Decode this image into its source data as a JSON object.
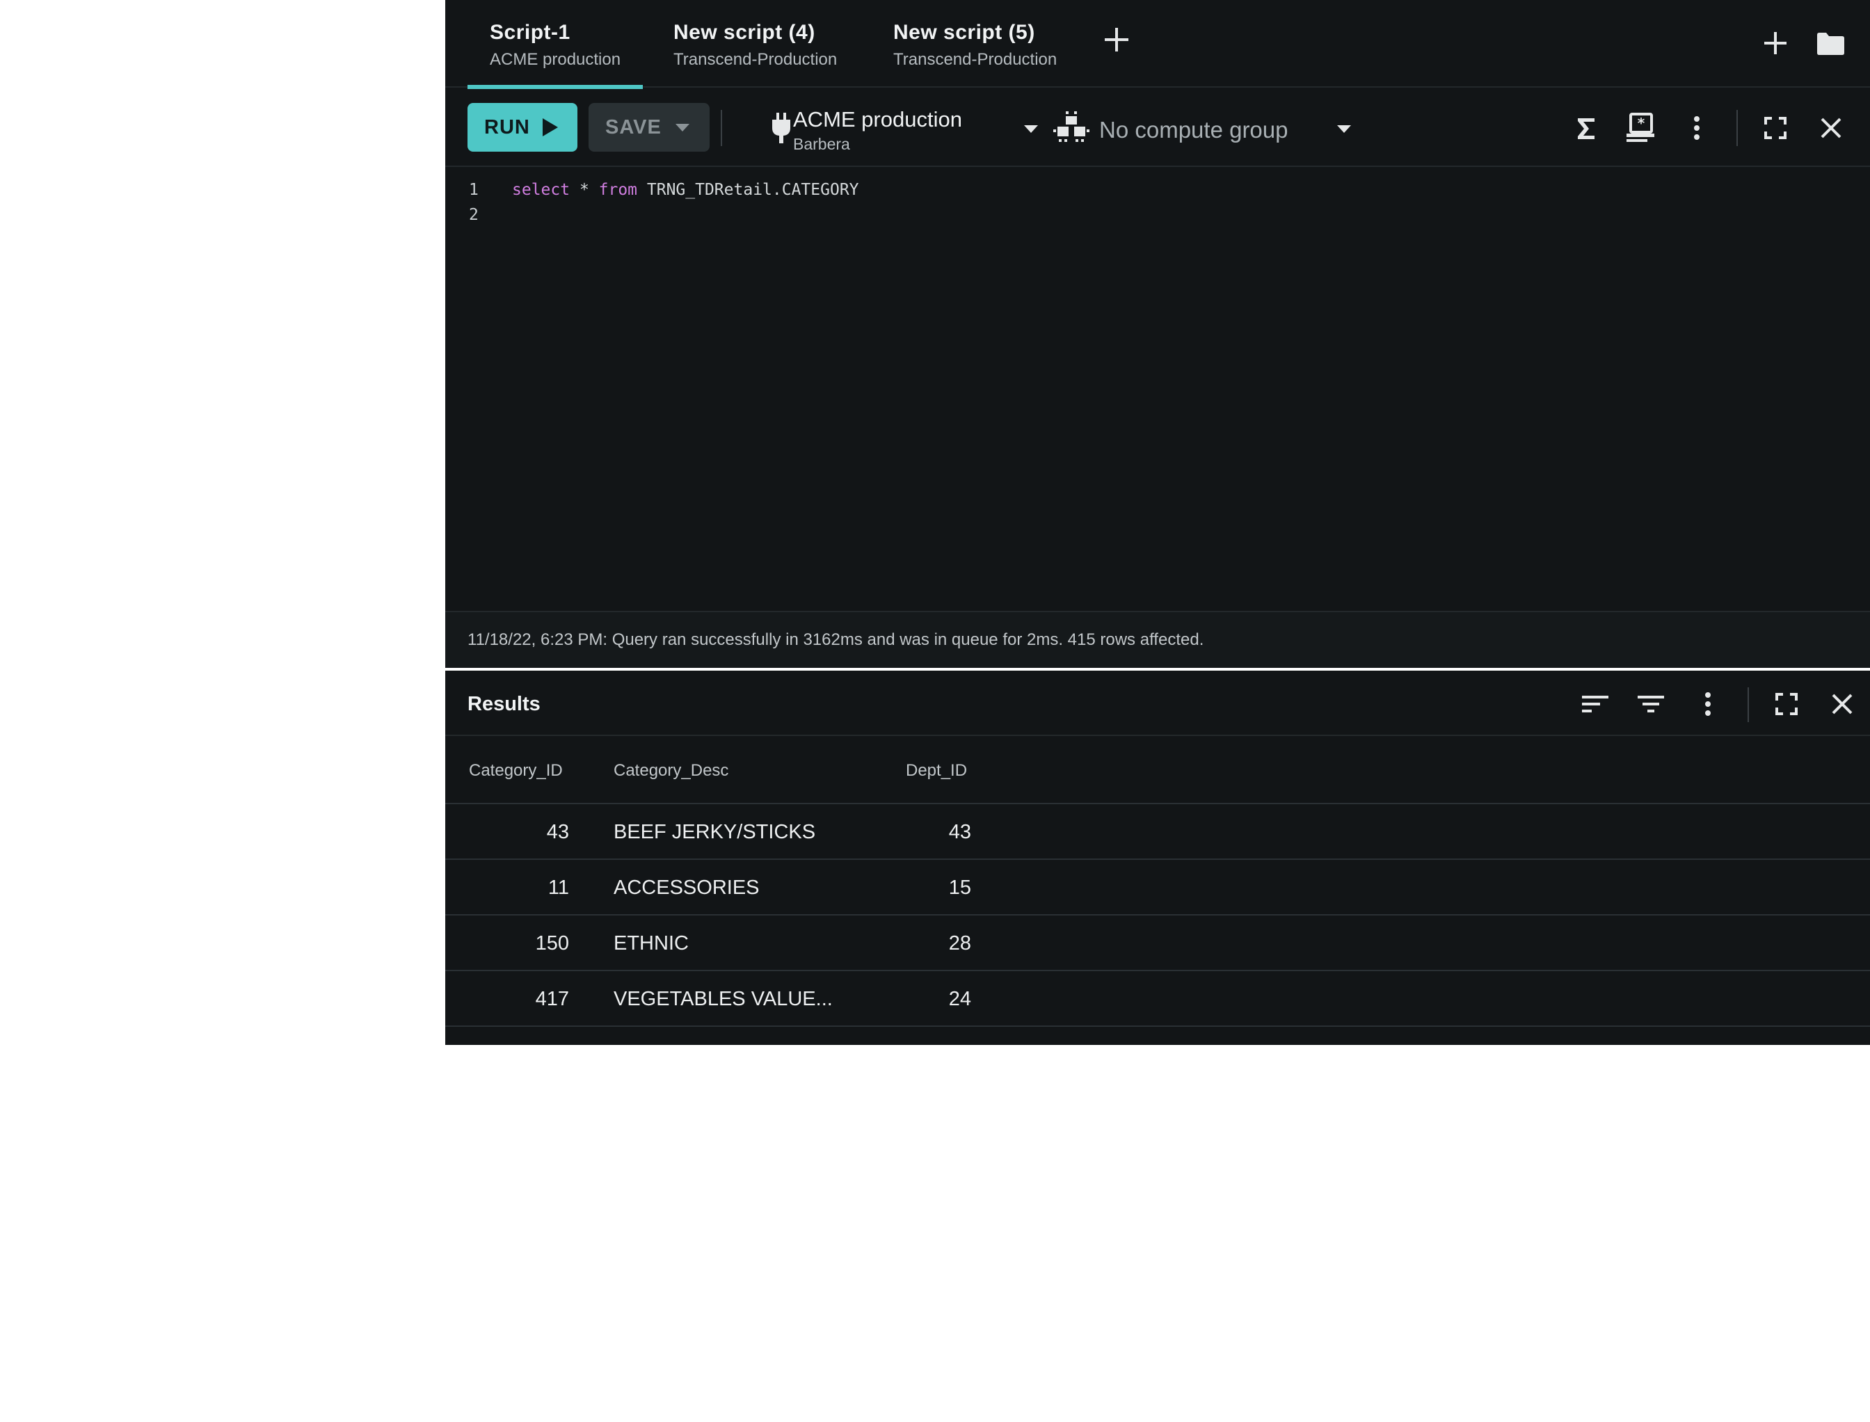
{
  "tabs": [
    {
      "title": "Script-1",
      "subtitle": "ACME production",
      "active": true
    },
    {
      "title": "New script (4)",
      "subtitle": "Transcend-Production",
      "active": false
    },
    {
      "title": "New script (5)",
      "subtitle": "Transcend-Production",
      "active": false
    }
  ],
  "toolbar": {
    "run_label": "RUN",
    "save_label": "SAVE",
    "connection_name": "ACME production",
    "connection_user": "Barbera",
    "compute_group": "No compute group"
  },
  "editor": {
    "lines": [
      {
        "number": "1",
        "tokens": [
          {
            "text": "select",
            "kind": "keyword"
          },
          {
            "text": " * ",
            "kind": "plain"
          },
          {
            "text": "from",
            "kind": "keyword"
          },
          {
            "text": " TRNG_TDRetail.CATEGORY",
            "kind": "plain"
          }
        ]
      },
      {
        "number": "2",
        "tokens": []
      }
    ]
  },
  "status": {
    "message": "11/18/22, 6:23 PM: Query ran successfully in 3162ms and was in queue for 2ms. 415 rows affected."
  },
  "results": {
    "title": "Results",
    "columns": [
      "Category_ID",
      "Category_Desc",
      "Dept_ID"
    ],
    "rows": [
      [
        "43",
        "BEEF JERKY/STICKS",
        "43"
      ],
      [
        "11",
        "ACCESSORIES",
        "15"
      ],
      [
        "150",
        "ETHNIC",
        "28"
      ],
      [
        "417",
        "VEGETABLES VALUE...",
        "24"
      ]
    ]
  },
  "icons": {
    "tab_add": "plus-icon",
    "new_script": "plus-icon",
    "open_folder": "folder-icon",
    "connection": "plug-icon",
    "compute_group": "compute-cluster-icon",
    "sum": "sigma-icon",
    "explain": "explain-icon",
    "more": "kebab-menu-icon",
    "maximize": "fullscreen-icon",
    "close": "close-icon",
    "sort": "sort-icon",
    "filter": "filter-icon"
  },
  "colors": {
    "accent": "#4ec7c6",
    "background": "#121517",
    "keyword": "#d07ee0"
  }
}
